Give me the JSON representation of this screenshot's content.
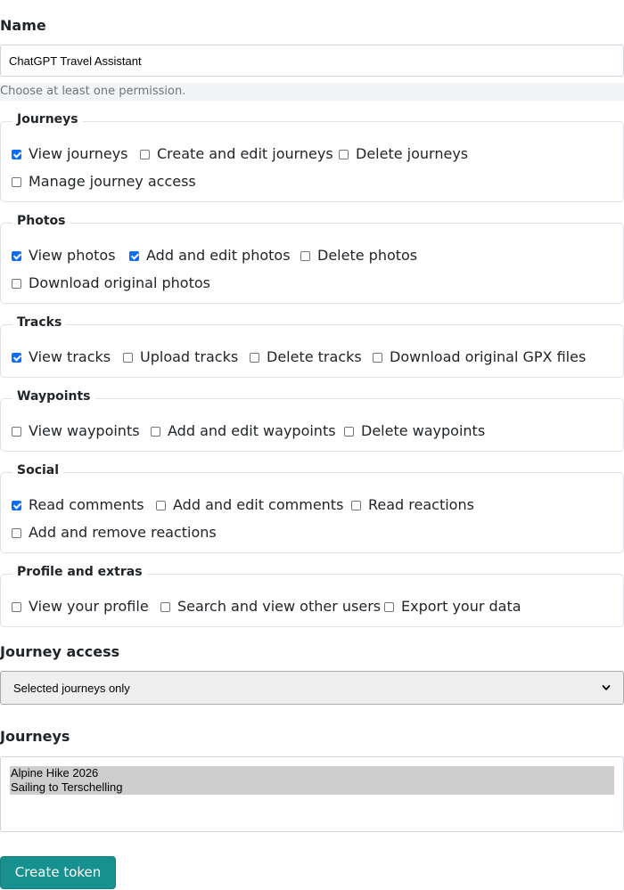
{
  "form": {
    "name_label": "Name",
    "name_value": "ChatGPT Travel Assistant",
    "permission_hint": "Choose at least one permission.",
    "journey_access_label": "Journey access",
    "journey_access_selected": "Selected journeys only",
    "journeys_label": "Journeys",
    "journeys_options": [
      "Alpine Hike 2026",
      "Sailing to Terschelling"
    ],
    "submit_label": "Create token"
  },
  "groups": [
    {
      "title": "Journeys",
      "options": [
        {
          "label": "View journeys",
          "checked": true
        },
        {
          "label": "Create and edit journeys",
          "checked": false
        },
        {
          "label": "Delete journeys",
          "checked": false
        },
        {
          "label": "Manage journey access",
          "checked": false
        }
      ]
    },
    {
      "title": "Photos",
      "options": [
        {
          "label": "View photos",
          "checked": true
        },
        {
          "label": "Add and edit photos",
          "checked": true
        },
        {
          "label": "Delete photos",
          "checked": false
        },
        {
          "label": "Download original photos",
          "checked": false
        }
      ]
    },
    {
      "title": "Tracks",
      "options": [
        {
          "label": "View tracks",
          "checked": true
        },
        {
          "label": "Upload tracks",
          "checked": false
        },
        {
          "label": "Delete tracks",
          "checked": false
        },
        {
          "label": "Download original GPX files",
          "checked": false
        }
      ]
    },
    {
      "title": "Waypoints",
      "options": [
        {
          "label": "View waypoints",
          "checked": false
        },
        {
          "label": "Add and edit waypoints",
          "checked": false
        },
        {
          "label": "Delete waypoints",
          "checked": false
        }
      ]
    },
    {
      "title": "Social",
      "options": [
        {
          "label": "Read comments",
          "checked": true
        },
        {
          "label": "Add and edit comments",
          "checked": false
        },
        {
          "label": "Read reactions",
          "checked": false
        },
        {
          "label": "Add and remove reactions",
          "checked": false
        }
      ]
    },
    {
      "title": "Profile and extras",
      "options": [
        {
          "label": "View your profile",
          "checked": false
        },
        {
          "label": "Search and view other users",
          "checked": false
        },
        {
          "label": "Export your data",
          "checked": false
        }
      ]
    }
  ]
}
